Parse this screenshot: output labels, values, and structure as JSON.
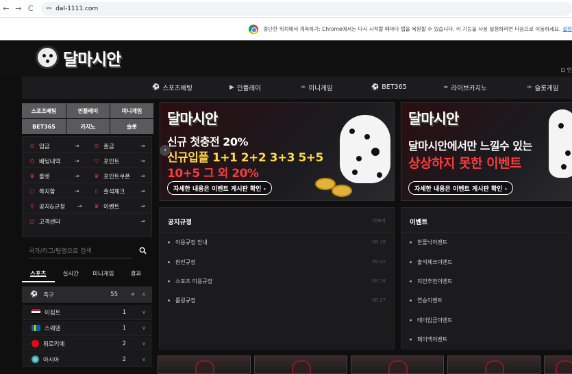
{
  "browser": {
    "url": "dal-1111.com",
    "back_glyph": "←",
    "forward_glyph": "→",
    "reload_glyph": "C",
    "tune_glyph": "⚯",
    "infobar_message": "중단한 위치에서 계속하기: Chrome에서는 다시 시작할 때마다 탭을 복원할 수 있습니다. 이 기능을 사용 설정하려면 다음으로 이동하세요.",
    "infobar_link": "설정"
  },
  "site": {
    "logo_text": "달마시안",
    "header_icon_glyph": "⊡ 인"
  },
  "main_nav": [
    {
      "icon": "⚽",
      "label": "스포츠배팅"
    },
    {
      "icon": "▶",
      "label": "인플레이"
    },
    {
      "icon": "∞",
      "label": "미니게임"
    },
    {
      "icon": "⚽",
      "label": "BET365"
    },
    {
      "icon": "∞",
      "label": "라이브카지노"
    },
    {
      "icon": "∞",
      "label": "슬롯게임"
    }
  ],
  "category_grid": [
    "스포츠배팅",
    "인플레이",
    "미니게임",
    "BET365",
    "카지노",
    "슬롯"
  ],
  "side_menu": {
    "arrow": "→",
    "rows": [
      [
        {
          "icon": "⊙",
          "label": "입금"
        },
        {
          "icon": "⊙",
          "label": "출금"
        }
      ],
      [
        {
          "icon": "◷",
          "label": "배팅내역"
        },
        {
          "icon": "▽",
          "label": "포인트"
        }
      ],
      [
        {
          "icon": "♛",
          "label": "룰렛"
        },
        {
          "icon": "♛",
          "label": "포인트쿠폰"
        }
      ],
      [
        {
          "icon": "▢",
          "label": "쪽지함"
        },
        {
          "icon": "▯",
          "label": "출석체크"
        }
      ],
      [
        {
          "icon": "⚲",
          "label": "공지&규정"
        },
        {
          "icon": "♛",
          "label": "이벤트"
        }
      ],
      [
        {
          "icon": "◫",
          "label": "고객센터"
        }
      ]
    ]
  },
  "search": {
    "placeholder": "국가/리그/팀명으로 검색"
  },
  "sport_tabs": [
    "스포츠",
    "실시간",
    "미니게임",
    "결과"
  ],
  "sport_list": {
    "star": "★",
    "chevron_up": "∧",
    "chevron_down": "∨",
    "head": {
      "icon": "⚽",
      "name": "축구",
      "count": "55"
    },
    "rows": [
      {
        "name": "이집트",
        "count": "1"
      },
      {
        "name": "스웨덴",
        "count": "1"
      },
      {
        "name": "튀르키예",
        "count": "2"
      },
      {
        "name": "아시아",
        "count": "2"
      }
    ]
  },
  "banner1": {
    "logo": "달마시안",
    "line1": "신규 첫충전 20%",
    "line2": "신규입플 1+1 2+2 3+3 5+5",
    "line3": "10+5 그 외 20%",
    "cta": "자세한 내용은 이벤트 게시판 확인 ›",
    "prev_glyph": "‹"
  },
  "banner2": {
    "logo": "달마시안",
    "line1": "달마시안에서만 느낄수 있는",
    "line2": "상상하지 못한 이벤트",
    "cta": "자세한 내용은 이벤트 게시판 확인 ›"
  },
  "notice_panel": {
    "title": "공지규정",
    "more": "더보기",
    "items": [
      {
        "text": "이용규정 안내",
        "date": "08.18"
      },
      {
        "text": "환전규정",
        "date": "09.02"
      },
      {
        "text": "스포츠 이용규정",
        "date": "08.18"
      },
      {
        "text": "롤링규정",
        "date": "08.27"
      }
    ]
  },
  "event_panel": {
    "title": "이벤트",
    "items": [
      "한폴낙이벤트",
      "출석체크이벤트",
      "지인추천이벤트",
      "연승이벤트",
      "테더입금이벤트",
      "페이백이벤트"
    ]
  },
  "colors": {
    "accent_red": "#e03a4a",
    "banner_yellow": "#ffd84a",
    "banner_red": "#ff3b3b"
  }
}
